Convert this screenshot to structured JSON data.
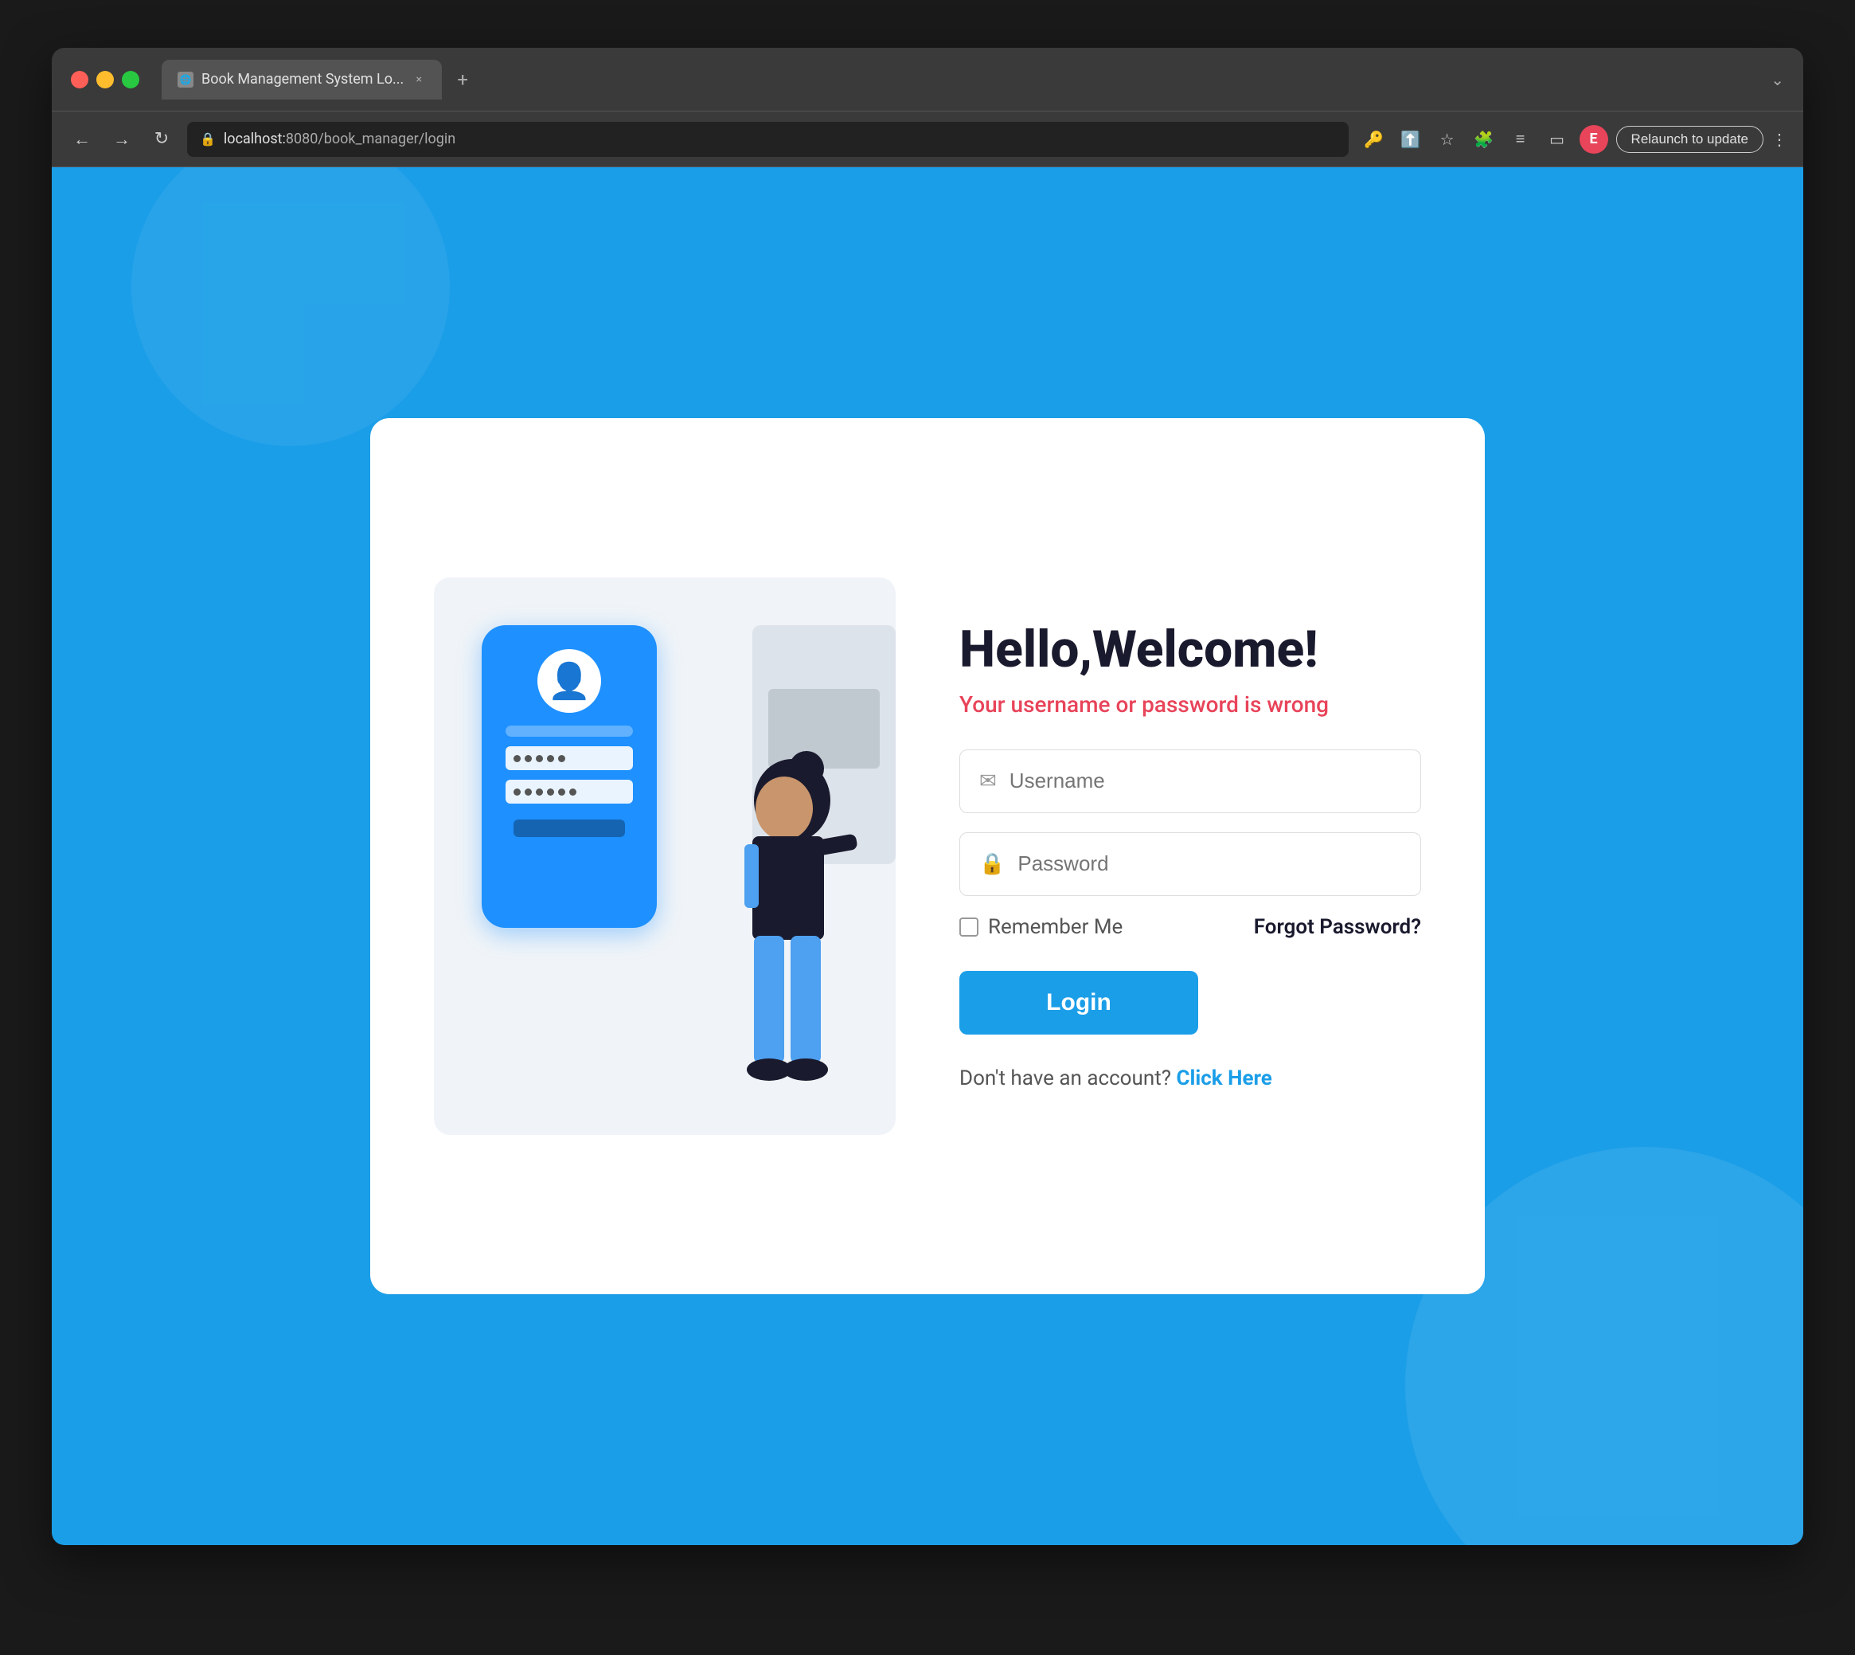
{
  "browser": {
    "titlebar": {
      "tab_title": "Book Management System Lo...",
      "tab_close": "×",
      "new_tab": "+",
      "menu_arrow": "⌄"
    },
    "navbar": {
      "back": "←",
      "forward": "→",
      "reload": "↻",
      "address": "localhost:8080/book_manager/login",
      "address_host": "localhost",
      "address_colon": ":",
      "address_port_path": "8080/book_manager/login",
      "relaunch_label": "Relaunch to update",
      "avatar_letter": "E"
    }
  },
  "page": {
    "title": "Hello,Welcome!",
    "error_message": "Your username or password is wrong",
    "username_placeholder": "Username",
    "password_placeholder": "Password",
    "remember_me_label": "Remember Me",
    "forgot_password_label": "Forgot Password?",
    "login_button_label": "Login",
    "signup_text": "Don't have an account?",
    "signup_link": "Click Here"
  }
}
